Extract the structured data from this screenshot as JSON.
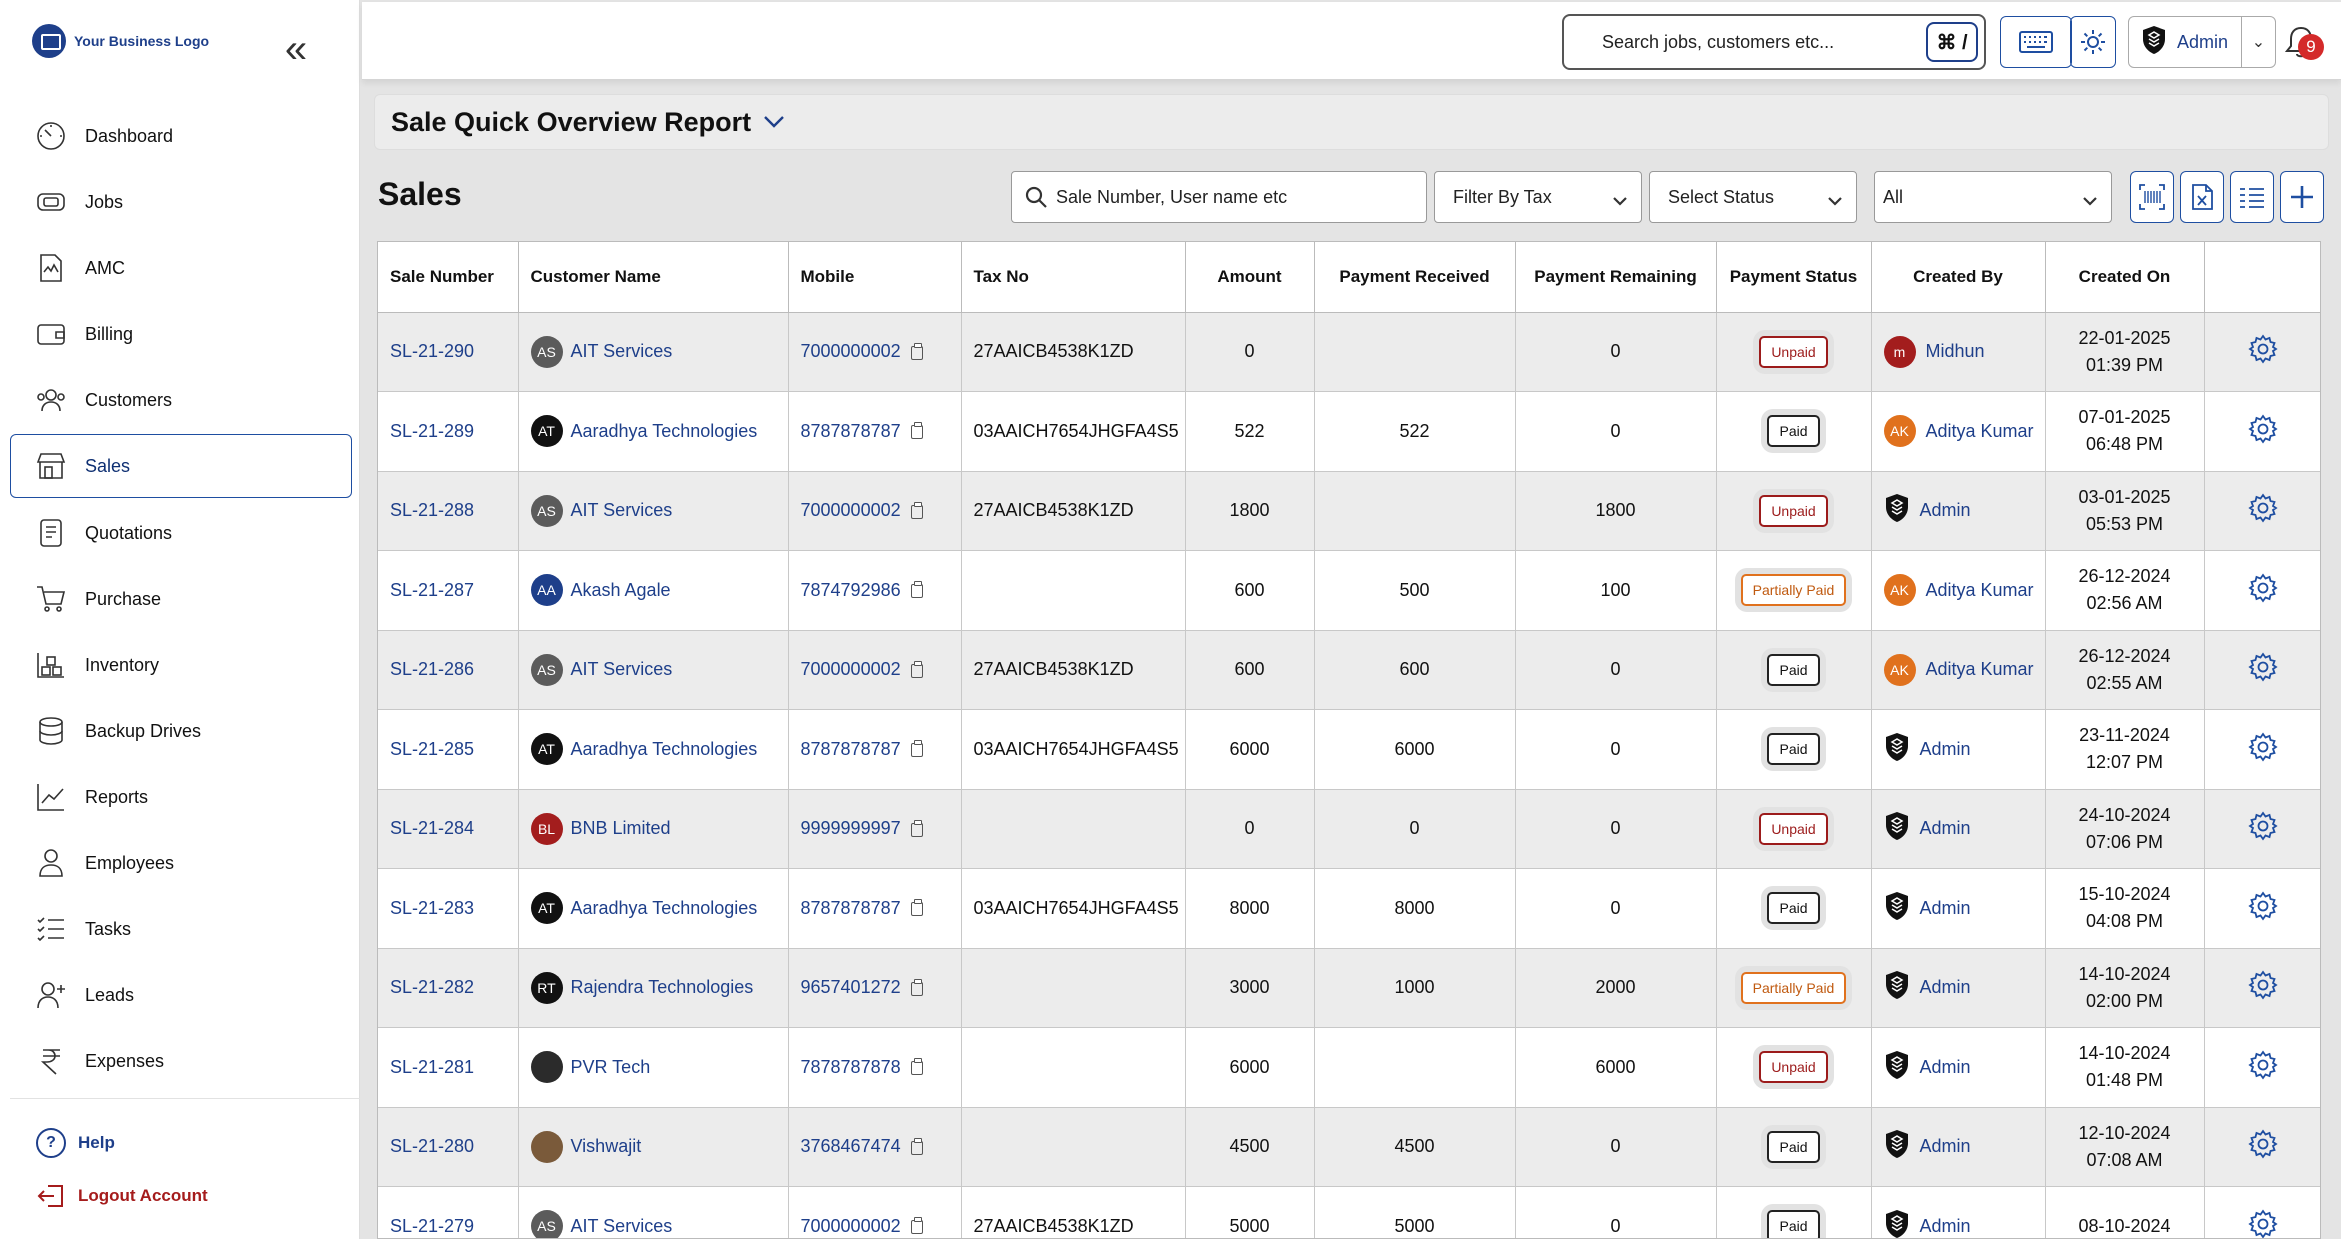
{
  "brand": {
    "logo_text": "Your Business Logo"
  },
  "sidebar": {
    "items": [
      {
        "key": "dashboard",
        "label": "Dashboard",
        "icon": "dashboard-icon"
      },
      {
        "key": "jobs",
        "label": "Jobs",
        "icon": "jobs-icon"
      },
      {
        "key": "amc",
        "label": "AMC",
        "icon": "amc-icon"
      },
      {
        "key": "billing",
        "label": "Billing",
        "icon": "wallet-icon"
      },
      {
        "key": "customers",
        "label": "Customers",
        "icon": "users-icon"
      },
      {
        "key": "sales",
        "label": "Sales",
        "icon": "store-icon",
        "active": true
      },
      {
        "key": "quotations",
        "label": "Quotations",
        "icon": "quotation-icon"
      },
      {
        "key": "purchase",
        "label": "Purchase",
        "icon": "cart-icon"
      },
      {
        "key": "inventory",
        "label": "Inventory",
        "icon": "inventory-icon"
      },
      {
        "key": "backup",
        "label": "Backup Drives",
        "icon": "database-icon"
      },
      {
        "key": "reports",
        "label": "Reports",
        "icon": "chart-icon"
      },
      {
        "key": "employees",
        "label": "Employees",
        "icon": "employee-icon"
      },
      {
        "key": "tasks",
        "label": "Tasks",
        "icon": "tasks-icon"
      },
      {
        "key": "leads",
        "label": "Leads",
        "icon": "add-user-icon"
      },
      {
        "key": "expenses",
        "label": "Expenses",
        "icon": "rupee-icon"
      }
    ],
    "help_label": "Help",
    "logout_label": "Logout Account"
  },
  "header": {
    "search_placeholder": "Search jobs, customers etc...",
    "shortcut": "⌘ /",
    "user_name": "Admin",
    "notification_count": "9"
  },
  "report": {
    "title": "Sale Quick Overview Report"
  },
  "sales": {
    "title": "Sales",
    "search_placeholder": "Sale Number, User name etc",
    "filter_tax": "Filter By Tax",
    "filter_status": "Select Status",
    "filter_all": "All"
  },
  "table": {
    "columns": [
      "Sale Number",
      "Customer Name",
      "Mobile",
      "Tax No",
      "Amount",
      "Payment Received",
      "Payment Remaining",
      "Payment Status",
      "Created By",
      "Created On"
    ],
    "rows": [
      {
        "sale": "SL-21-290",
        "initials": "AS",
        "avatar_color": "#5b5b5b",
        "customer": "AIT Services",
        "mobile": "7000000002",
        "tax": "27AAICB4538K1ZD",
        "amount": "0",
        "received": "",
        "remaining": "0",
        "status": "Unpaid",
        "status_type": "unpaid",
        "creator_initials": "m",
        "creator_color": "#a31d1d",
        "creator": "Midhun",
        "date": "22-01-2025",
        "time": "01:39 PM"
      },
      {
        "sale": "SL-21-289",
        "initials": "AT",
        "avatar_color": "#111111",
        "customer": "Aaradhya Technologies",
        "mobile": "8787878787",
        "tax": "03AAICH7654JHGFA4S5",
        "amount": "522",
        "received": "522",
        "remaining": "0",
        "status": "Paid",
        "status_type": "paid",
        "creator_initials": "AK",
        "creator_color": "#e0711d",
        "creator": "Aditya Kumar",
        "date": "07-01-2025",
        "time": "06:48 PM"
      },
      {
        "sale": "SL-21-288",
        "initials": "AS",
        "avatar_color": "#5b5b5b",
        "customer": "AIT Services",
        "mobile": "7000000002",
        "tax": "27AAICB4538K1ZD",
        "amount": "1800",
        "received": "",
        "remaining": "1800",
        "status": "Unpaid",
        "status_type": "unpaid",
        "creator_initials": "",
        "creator_color": "shield",
        "creator": "Admin",
        "date": "03-01-2025",
        "time": "05:53 PM"
      },
      {
        "sale": "SL-21-287",
        "initials": "AA",
        "avatar_color": "#1e3f8a",
        "customer": "Akash Agale",
        "mobile": "7874792986",
        "tax": "",
        "amount": "600",
        "received": "500",
        "remaining": "100",
        "status": "Partially Paid",
        "status_type": "partial",
        "creator_initials": "AK",
        "creator_color": "#e0711d",
        "creator": "Aditya Kumar",
        "date": "26-12-2024",
        "time": "02:56 AM"
      },
      {
        "sale": "SL-21-286",
        "initials": "AS",
        "avatar_color": "#5b5b5b",
        "customer": "AIT Services",
        "mobile": "7000000002",
        "tax": "27AAICB4538K1ZD",
        "amount": "600",
        "received": "600",
        "remaining": "0",
        "status": "Paid",
        "status_type": "paid",
        "creator_initials": "AK",
        "creator_color": "#e0711d",
        "creator": "Aditya Kumar",
        "date": "26-12-2024",
        "time": "02:55 AM"
      },
      {
        "sale": "SL-21-285",
        "initials": "AT",
        "avatar_color": "#111111",
        "customer": "Aaradhya Technologies",
        "mobile": "8787878787",
        "tax": "03AAICH7654JHGFA4S5",
        "amount": "6000",
        "received": "6000",
        "remaining": "0",
        "status": "Paid",
        "status_type": "paid",
        "creator_initials": "",
        "creator_color": "shield",
        "creator": "Admin",
        "date": "23-11-2024",
        "time": "12:07 PM"
      },
      {
        "sale": "SL-21-284",
        "initials": "BL",
        "avatar_color": "#a31d1d",
        "customer": "BNB Limited",
        "mobile": "9999999997",
        "tax": "",
        "amount": "0",
        "received": "0",
        "remaining": "0",
        "status": "Unpaid",
        "status_type": "unpaid",
        "creator_initials": "",
        "creator_color": "shield",
        "creator": "Admin",
        "date": "24-10-2024",
        "time": "07:06 PM"
      },
      {
        "sale": "SL-21-283",
        "initials": "AT",
        "avatar_color": "#111111",
        "customer": "Aaradhya Technologies",
        "mobile": "8787878787",
        "tax": "03AAICH7654JHGFA4S5",
        "amount": "8000",
        "received": "8000",
        "remaining": "0",
        "status": "Paid",
        "status_type": "paid",
        "creator_initials": "",
        "creator_color": "shield",
        "creator": "Admin",
        "date": "15-10-2024",
        "time": "04:08 PM"
      },
      {
        "sale": "SL-21-282",
        "initials": "RT",
        "avatar_color": "#111111",
        "customer": "Rajendra Technologies",
        "mobile": "9657401272",
        "tax": "",
        "amount": "3000",
        "received": "1000",
        "remaining": "2000",
        "status": "Partially Paid",
        "status_type": "partial",
        "creator_initials": "",
        "creator_color": "shield",
        "creator": "Admin",
        "date": "14-10-2024",
        "time": "02:00 PM"
      },
      {
        "sale": "SL-21-281",
        "initials": "",
        "avatar_color": "#2b2b2b",
        "customer": "PVR Tech",
        "mobile": "7878787878",
        "tax": "",
        "amount": "6000",
        "received": "",
        "remaining": "6000",
        "status": "Unpaid",
        "status_type": "unpaid",
        "creator_initials": "",
        "creator_color": "shield",
        "creator": "Admin",
        "date": "14-10-2024",
        "time": "01:48 PM"
      },
      {
        "sale": "SL-21-280",
        "initials": "",
        "avatar_color": "#7a5a3a",
        "customer": "Vishwajit",
        "mobile": "3768467474",
        "tax": "",
        "amount": "4500",
        "received": "4500",
        "remaining": "0",
        "status": "Paid",
        "status_type": "paid",
        "creator_initials": "",
        "creator_color": "shield",
        "creator": "Admin",
        "date": "12-10-2024",
        "time": "07:08 AM"
      },
      {
        "sale": "SL-21-279",
        "initials": "AS",
        "avatar_color": "#5b5b5b",
        "customer": "AIT Services",
        "mobile": "7000000002",
        "tax": "27AAICB4538K1ZD",
        "amount": "5000",
        "received": "5000",
        "remaining": "0",
        "status": "Paid",
        "status_type": "paid",
        "creator_initials": "",
        "creator_color": "shield",
        "creator": "Admin",
        "date": "08-10-2024",
        "time": ""
      }
    ]
  }
}
